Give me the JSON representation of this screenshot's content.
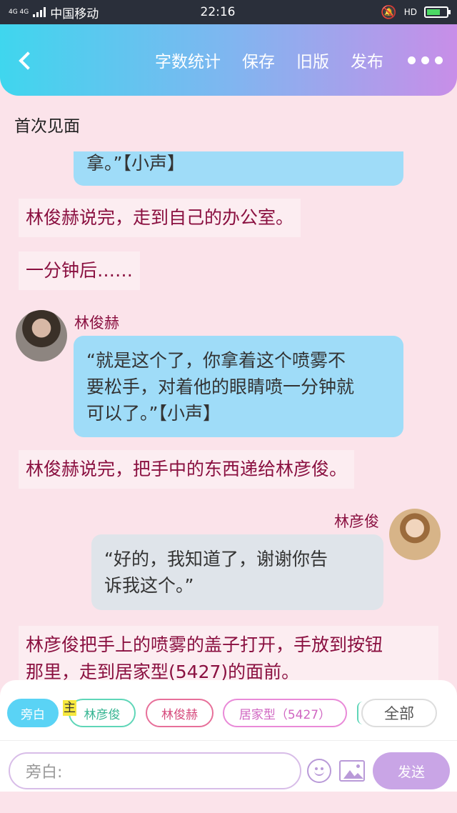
{
  "status_bar": {
    "signal": "4G 4G",
    "carrier": "中国移动",
    "time": "22:16",
    "network_badge": "HD"
  },
  "header": {
    "back_icon": "back-chevron",
    "actions": [
      "字数统计",
      "保存",
      "旧版",
      "发布"
    ],
    "more_icon": "more-dots"
  },
  "document": {
    "title": "首次见面"
  },
  "messages": {
    "m0": "拿。”【小声】",
    "m1": "林俊赫说完，走到自己的办公室。",
    "m2": "一分钟后……",
    "m3_speaker": "林俊赫",
    "m3_line1": "“就是这个了，你拿着这个喷雾不",
    "m3_line2": "要松手，对着他的眼睛喷一分钟就",
    "m3_line3": "可以了。”【小声】",
    "m4": "林俊赫说完，把手中的东西递给林彦俊。",
    "m5_speaker": "林彦俊",
    "m5_line1": "“好的，我知道了，谢谢你告",
    "m5_line2": "诉我这个。”",
    "m6_line1": "林彦俊把手上的喷雾的盖子打开，手放到按钮",
    "m6_line2": "那里，走到居家型(5427)的面前。"
  },
  "roles": {
    "narration": "旁白",
    "main_tag": "主",
    "role1": "林彦俊",
    "role2": "林俊赫",
    "role3": "居家型（5427）",
    "all": "全部"
  },
  "composer": {
    "placeholder": "旁白:",
    "send": "发送"
  },
  "colors": {
    "header_start": "#3fd6ee",
    "header_end": "#c88ee8",
    "background": "#fbe3ea",
    "narration_text": "#8a1040",
    "bubble_blue": "#9fdcf8",
    "bubble_gray": "#dfe4ea",
    "send_button": "#c9a5e6"
  }
}
